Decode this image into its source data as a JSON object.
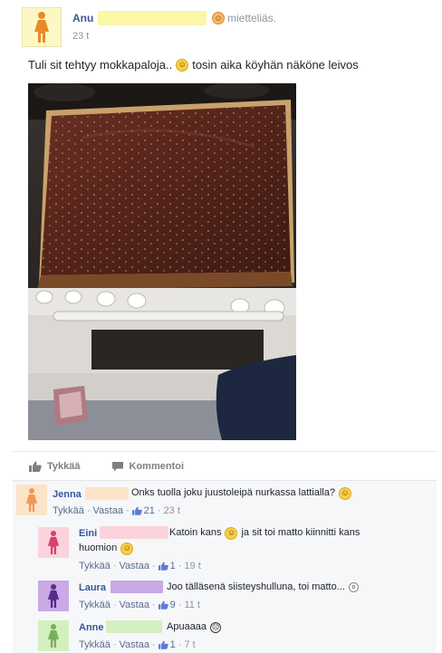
{
  "post": {
    "author": "Anu",
    "feeling": "mietteliäs.",
    "time": "23 t",
    "text_main": "Tuli sit tehtyy mokkapaloja..",
    "text_tail": "tosin aika köyhän näköne leivos"
  },
  "actions": {
    "like": "Tykkää",
    "comment": "Kommentoi"
  },
  "comments": [
    {
      "name": "Jenna",
      "text": "Onks tuolla joku juustoleipä nurkassa lattialla?",
      "like": "Tykkää",
      "reply": "Vastaa",
      "likes": "21",
      "time": "23 t"
    },
    {
      "name": "Eini",
      "text_1": "Katoin kans",
      "text_2": "ja sit toi matto kiinnitti kans",
      "text_3": "huomion",
      "like": "Tykkää",
      "reply": "Vastaa",
      "likes": "1",
      "time": "19 t"
    },
    {
      "name": "Laura",
      "text": "Joo tälläsenä siisteyshulluna, toi matto...",
      "like": "Tykkää",
      "reply": "Vastaa",
      "likes": "9",
      "time": "11 t"
    },
    {
      "name": "Anne",
      "text": "Apuaaaa",
      "like": "Tykkää",
      "reply": "Vastaa",
      "likes": "1",
      "time": "7 t"
    }
  ],
  "colors": {
    "link_blue": "#3b5998",
    "avatar_post": "#fdf7c5",
    "avatar_jenna": "#fde3c8",
    "avatar_eini": "#fbd3dc",
    "avatar_laura": "#c9a9e6",
    "avatar_anne": "#d4f0c0"
  },
  "icons": [
    "person-icon",
    "smiley-icon",
    "thumbs-up-icon",
    "comment-icon",
    "surprised-face-icon",
    "scared-face-icon"
  ]
}
